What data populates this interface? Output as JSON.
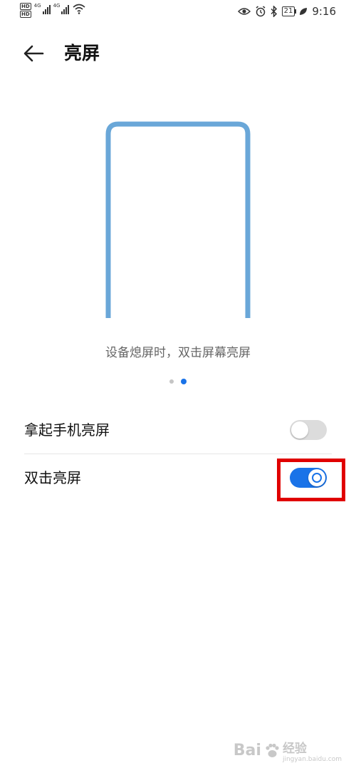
{
  "status_bar": {
    "hd_badges": [
      "HD",
      "HD"
    ],
    "net_labels": [
      "4G",
      "4G"
    ],
    "battery": "21",
    "time": "9:16",
    "icons": [
      "eye-comfort-icon",
      "alarm-icon",
      "bluetooth-icon",
      "battery-icon",
      "leaf-icon",
      "wifi-icon"
    ]
  },
  "header": {
    "title": "亮屏"
  },
  "illustration": {
    "stroke_color": "#6aa7d8"
  },
  "caption": "设备熄屏时，双击屏幕亮屏",
  "pager": {
    "count": 2,
    "active_index": 1
  },
  "settings": [
    {
      "label": "拿起手机亮屏",
      "enabled": false
    },
    {
      "label": "双击亮屏",
      "enabled": true
    }
  ],
  "colors": {
    "accent": "#1a73e8",
    "toggle_off": "#dcdcdc",
    "highlight": "#e00000"
  },
  "watermark": {
    "brand": "Bai",
    "cn": "经验",
    "site": "jingyan.baidu.com"
  }
}
